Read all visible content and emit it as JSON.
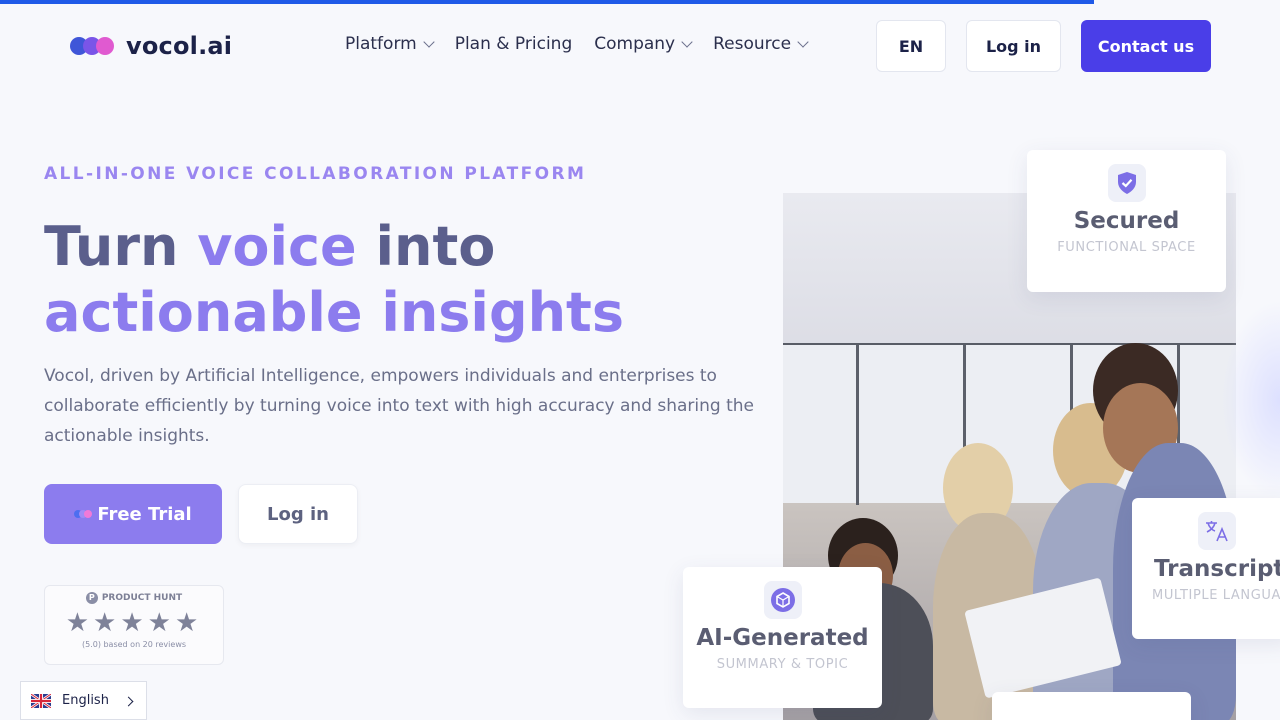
{
  "brand": {
    "logo_text": "vocol.ai"
  },
  "nav": {
    "items": [
      {
        "label": "Platform",
        "has_dropdown": true
      },
      {
        "label": "Plan & Pricing",
        "has_dropdown": false
      },
      {
        "label": "Company",
        "has_dropdown": true
      },
      {
        "label": "Resource",
        "has_dropdown": true
      }
    ],
    "language_label": "EN",
    "login_label": "Log in",
    "contact_label": "Contact us"
  },
  "hero": {
    "eyebrow": "ALL-IN-ONE VOICE COLLABORATION PLATFORM",
    "headline_part1": "Turn ",
    "headline_accent1": "voice",
    "headline_part2": " into",
    "headline_accent2": "actionable insights",
    "description": "Vocol, driven by Artificial Intelligence, empowers individuals and enterprises to collaborate efficiently by turning voice into text with high accuracy and sharing the actionable insights.",
    "free_trial_label": "Free Trial",
    "login_label": "Log in"
  },
  "product_hunt": {
    "badge_letter": "P",
    "label": "PRODUCT HUNT",
    "stars": "★★★★★",
    "rating": 5,
    "reviews_text": "(5.0) based on 20 reviews"
  },
  "language_selector": {
    "label": "English"
  },
  "feature_cards": {
    "secured": {
      "title": "Secured",
      "subtitle": "FUNCTIONAL SPACE",
      "icon": "shield-check-icon"
    },
    "ai": {
      "title": "AI-Generated",
      "subtitle": "SUMMARY & TOPIC",
      "icon": "ai-hexagon-icon"
    },
    "transcription": {
      "title": "Transcripti",
      "subtitle": "MULTIPLE LANGUA",
      "icon": "translate-icon"
    }
  },
  "colors": {
    "primary": "#4a3ee8",
    "accent": "#8c7cee",
    "progress": "#1f5ae8",
    "text_dark": "#1c2248"
  }
}
